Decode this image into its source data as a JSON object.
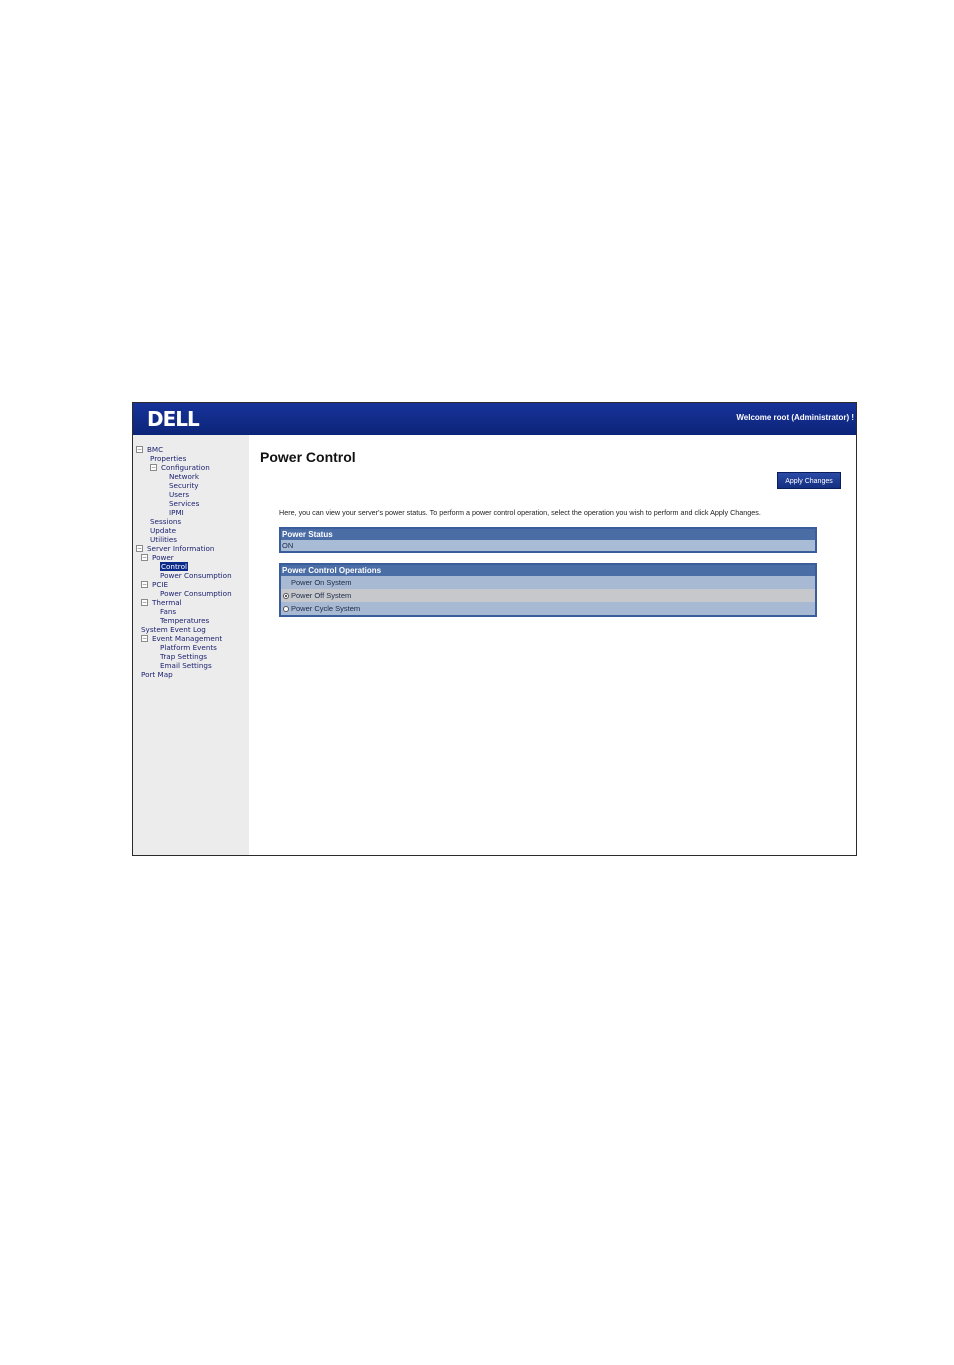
{
  "header": {
    "logo": "DELL",
    "welcome": "Welcome root (Administrator) !"
  },
  "sidebar": {
    "tree": [
      {
        "label": "BMC",
        "toggle": "⊟"
      },
      {
        "label": "Properties"
      },
      {
        "label": "Configuration",
        "toggle": "⊟"
      },
      {
        "label": "Network"
      },
      {
        "label": "Security"
      },
      {
        "label": "Users"
      },
      {
        "label": "Services"
      },
      {
        "label": "IPMI"
      },
      {
        "label": "Sessions"
      },
      {
        "label": "Update"
      },
      {
        "label": "Utilities"
      },
      {
        "label": "Server Information",
        "toggle": "⊟"
      },
      {
        "label": "Power",
        "toggle": "⊟"
      },
      {
        "label": "Control",
        "selected": true
      },
      {
        "label": "Power Consumption"
      },
      {
        "label": "PCIE",
        "toggle": "⊟"
      },
      {
        "label": "Power Consumption"
      },
      {
        "label": "Thermal",
        "toggle": "⊟"
      },
      {
        "label": "Fans"
      },
      {
        "label": "Temperatures"
      },
      {
        "label": "System Event Log"
      },
      {
        "label": "Event Management",
        "toggle": "⊟"
      },
      {
        "label": "Platform Events"
      },
      {
        "label": "Trap Settings"
      },
      {
        "label": "Email Settings"
      },
      {
        "label": "Port Map"
      }
    ]
  },
  "main": {
    "title": "Power Control",
    "apply_label": "Apply Changes",
    "description": "Here, you can view your server's power status. To perform a power control operation, select the operation you wish to perform and click Apply Changes.",
    "power_status": {
      "heading": "Power Status",
      "value": "ON"
    },
    "operations": {
      "heading": "Power Control Operations",
      "options": [
        {
          "label": "Power On System",
          "state": "unavailable"
        },
        {
          "label": "Power Off System",
          "state": "selected"
        },
        {
          "label": "Power Cycle System",
          "state": "unselected"
        }
      ]
    }
  }
}
